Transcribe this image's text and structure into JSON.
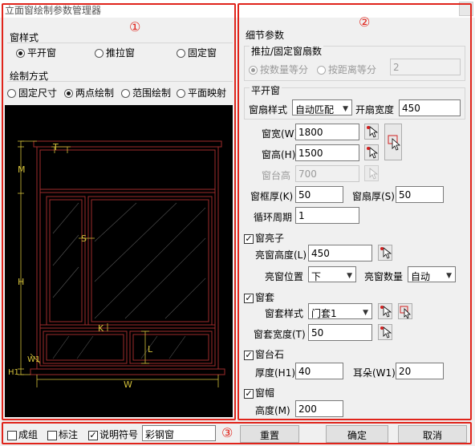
{
  "window": {
    "title": "立面窗绘制参数管理器"
  },
  "markers": {
    "left": "①",
    "right": "②",
    "bottom": "③"
  },
  "left": {
    "window_style": {
      "title": "窗样式",
      "options": [
        {
          "label": "平开窗",
          "selected": true
        },
        {
          "label": "推拉窗",
          "selected": false
        },
        {
          "label": "固定窗",
          "selected": false
        }
      ]
    },
    "draw_mode": {
      "title": "绘制方式",
      "options": [
        {
          "label": "固定尺寸",
          "selected": false
        },
        {
          "label": "两点绘制",
          "selected": true
        },
        {
          "label": "范围绘制",
          "selected": false
        },
        {
          "label": "平面映射",
          "selected": false
        }
      ]
    },
    "preview_labels": {
      "t": "T",
      "m": "M",
      "s": "S",
      "h": "H",
      "k": "K",
      "l": "L",
      "w1": "W1",
      "h1": "H1",
      "w": "W"
    },
    "colors": {
      "frame": "#9e2b2b",
      "dim": "#d4c13a",
      "bg": "#000000"
    }
  },
  "right": {
    "title": "细节参数",
    "push_fixed": {
      "title": "推拉/固定窗扇数",
      "opt_count": "按数量等分",
      "opt_distance": "按距离等分",
      "value": "2"
    },
    "casement": {
      "title": "平开窗",
      "sash_style_label": "窗扇样式",
      "sash_style_value": "自动匹配",
      "sash_width_label": "开扇宽度",
      "sash_width_value": "450"
    },
    "width": {
      "label": "窗宽(W)",
      "value": "1800"
    },
    "height": {
      "label": "窗高(H)",
      "value": "1500"
    },
    "sill_height": {
      "label": "窗台高",
      "value": "700"
    },
    "frame_thick": {
      "label": "窗框厚(K)",
      "value": "50"
    },
    "sash_thick": {
      "label": "窗扇厚(S)",
      "value": "50"
    },
    "cycle": {
      "label": "循环周期",
      "value": "1"
    },
    "transom": {
      "label": "窗亮子",
      "checked": true,
      "height_label": "亮窗高度(L)",
      "height_value": "450",
      "position_label": "亮窗位置",
      "position_value": "下",
      "count_label": "亮窗数量",
      "count_value": "自动"
    },
    "casing": {
      "label": "窗套",
      "checked": true,
      "style_label": "窗套样式",
      "style_value": "门套1",
      "width_label": "窗套宽度(T)",
      "width_value": "50"
    },
    "sill_stone": {
      "label": "窗台石",
      "checked": true,
      "thick_label": "厚度(H1)",
      "thick_value": "40",
      "ear_label": "耳朵(W1)",
      "ear_value": "20"
    },
    "hood": {
      "label": "窗帽",
      "checked": true,
      "height_label": "高度(M)",
      "height_value": "200"
    }
  },
  "bottom": {
    "group": {
      "label": "成组",
      "checked": false
    },
    "annotate": {
      "label": "标注",
      "checked": false
    },
    "symbol": {
      "label": "说明符号",
      "checked": true,
      "value": "彩钢窗"
    },
    "reset": "重置",
    "ok": "确定",
    "cancel": "取消"
  },
  "accent": "#e0241b"
}
